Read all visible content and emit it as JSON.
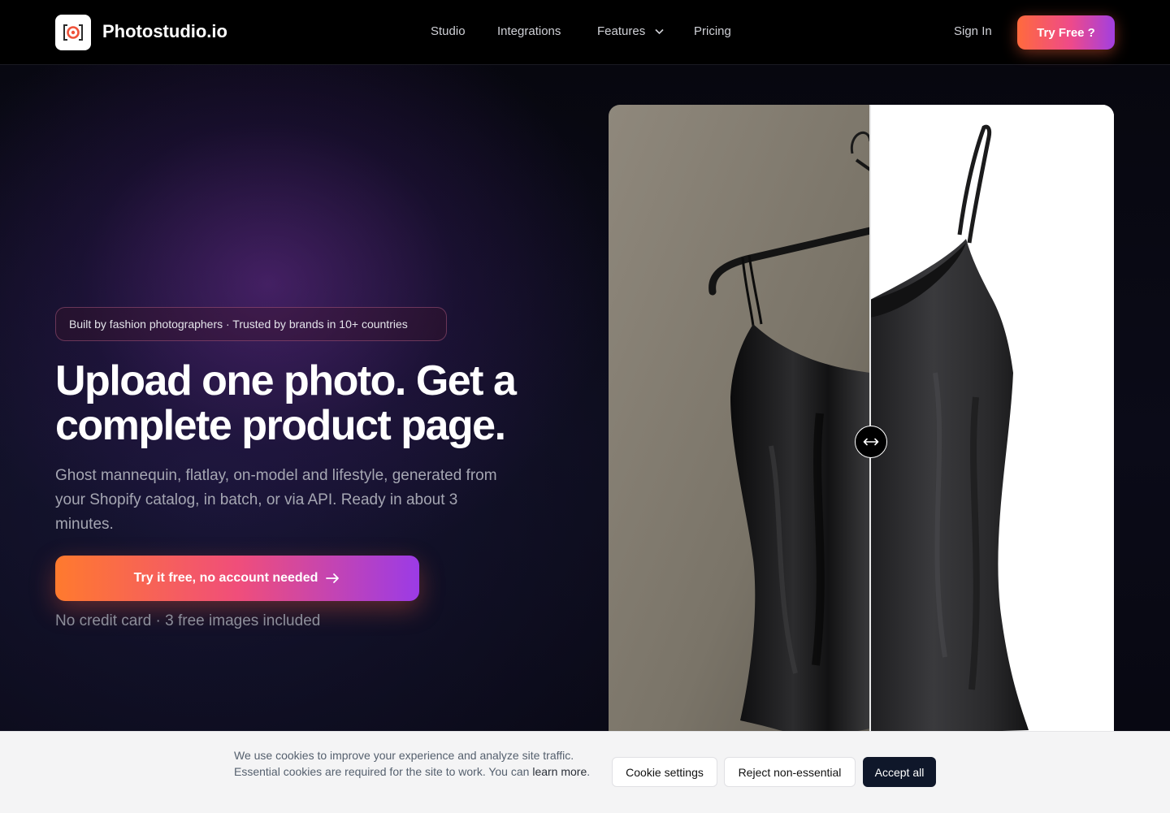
{
  "nav": {
    "brand": "Photostudio.io",
    "links": [
      "Studio",
      "Integrations",
      "Features",
      "Pricing"
    ],
    "sign_in": "Sign In",
    "try_free": "Try Free ?"
  },
  "hero": {
    "badge": "Built by fashion photographers · Trusted by brands in 10+ countries",
    "headline": "Upload one photo. Get a complete product page.",
    "subcopy": "Ghost mannequin, flatlay, on-model and lifestyle, generated from your Shopify catalog, in batch, or via API. Ready in about 3 minutes.",
    "cta": "Try it free, no account needed",
    "note": "No credit card · 3 free images included"
  },
  "cookie_banner": {
    "text": "We use cookies to improve your experience and analyze site traffic. Essential cookies are required for the site to work. You can",
    "learn_more": "learn more",
    "settings": "Cookie settings",
    "reject": "Reject non-essential",
    "accept": "Accept all"
  },
  "colors": {
    "accent_start": "#ff6a3d",
    "accent_mid": "#ee4a8a",
    "accent_end": "#a23fe0",
    "accept_button": "#0f172a"
  }
}
